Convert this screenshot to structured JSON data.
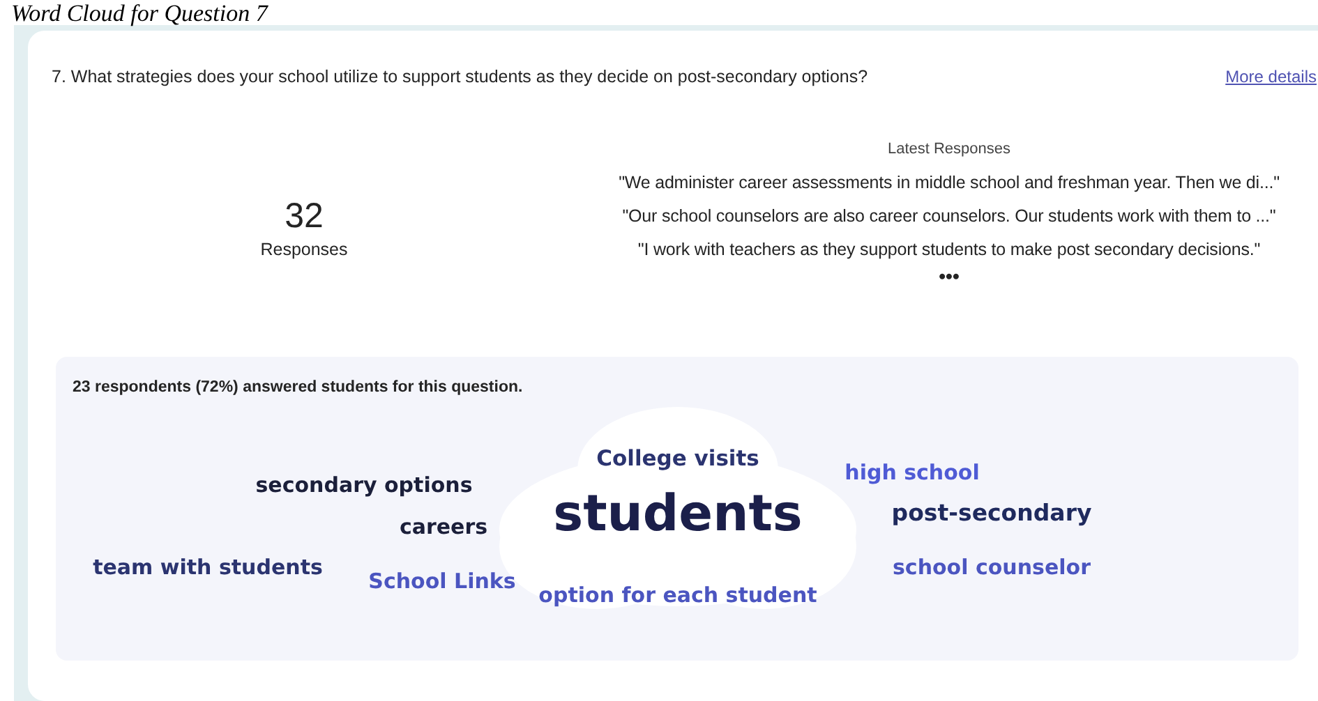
{
  "caption": "Word Cloud for Question 7",
  "question": {
    "text": "7. What strategies does your school utilize to support students as they decide on post-secondary options?",
    "link": "More details"
  },
  "summary": {
    "count": "32",
    "label": "Responses"
  },
  "latest": {
    "title": "Latest Responses",
    "responses": [
      "\"We administer career assessments in middle school and freshman year. Then we di...\"",
      "\"Our school counselors are also career counselors. Our students work with them to ...\"",
      "\"I work with teachers as they support students to make post secondary decisions.\""
    ],
    "more": "•••"
  },
  "word_cloud": {
    "summary": "23 respondents (72%) answered students for this question.",
    "words": [
      {
        "text": "College visits",
        "color": "#2b3470"
      },
      {
        "text": "students",
        "color": "#1b1f4a"
      },
      {
        "text": "option for each student",
        "color": "#4b55c0"
      },
      {
        "text": "secondary options",
        "color": "#1b1f3a"
      },
      {
        "text": "careers",
        "color": "#1b1f3a"
      },
      {
        "text": "team with students",
        "color": "#2b3470"
      },
      {
        "text": "School Links",
        "color": "#4b55c0"
      },
      {
        "text": "high school",
        "color": "#4f5bd5"
      },
      {
        "text": "post-secondary",
        "color": "#1f2a5e"
      },
      {
        "text": "school counselor",
        "color": "#4b55c0"
      }
    ]
  }
}
